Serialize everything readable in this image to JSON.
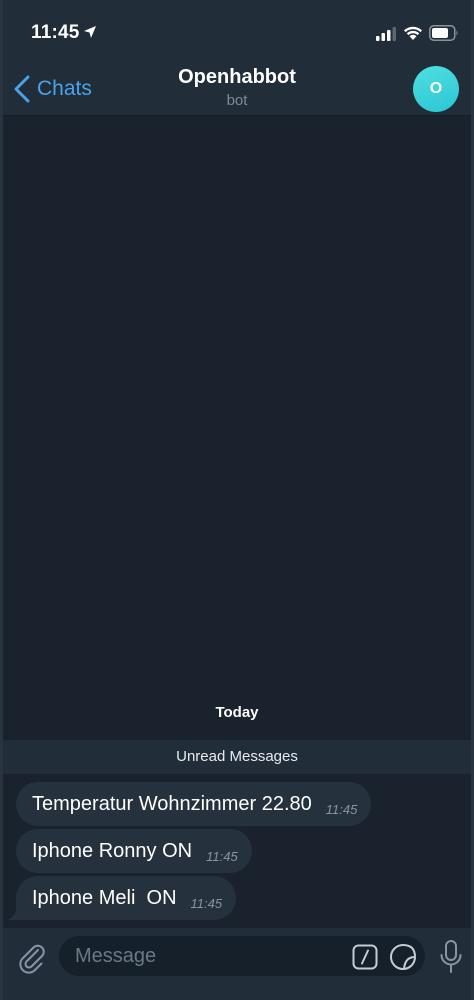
{
  "status_bar": {
    "time": "11:45",
    "icons": [
      "location-arrow-icon",
      "signal-icon",
      "wifi-icon",
      "battery-icon"
    ]
  },
  "header": {
    "back_label": "Chats",
    "title": "Openhabbot",
    "subtitle": "bot",
    "avatar_initial": "O",
    "avatar_color": "#3fd3dc"
  },
  "chat": {
    "date_label": "Today",
    "unread_label": "Unread Messages",
    "messages": [
      {
        "text": "Temperatur Wohnzimmer 22.80",
        "time": "11:45"
      },
      {
        "text": "Iphone Ronny ON",
        "time": "11:45"
      },
      {
        "text": "Iphone Meli  ON",
        "time": "11:45"
      }
    ]
  },
  "input_bar": {
    "placeholder": "Message",
    "icons": [
      "paperclip-icon",
      "bot-command-icon",
      "sticker-icon",
      "microphone-icon"
    ]
  },
  "colors": {
    "accent": "#4aa3ea",
    "background": "#19222d",
    "bar": "#222d3a",
    "bubble": "#26313e"
  }
}
